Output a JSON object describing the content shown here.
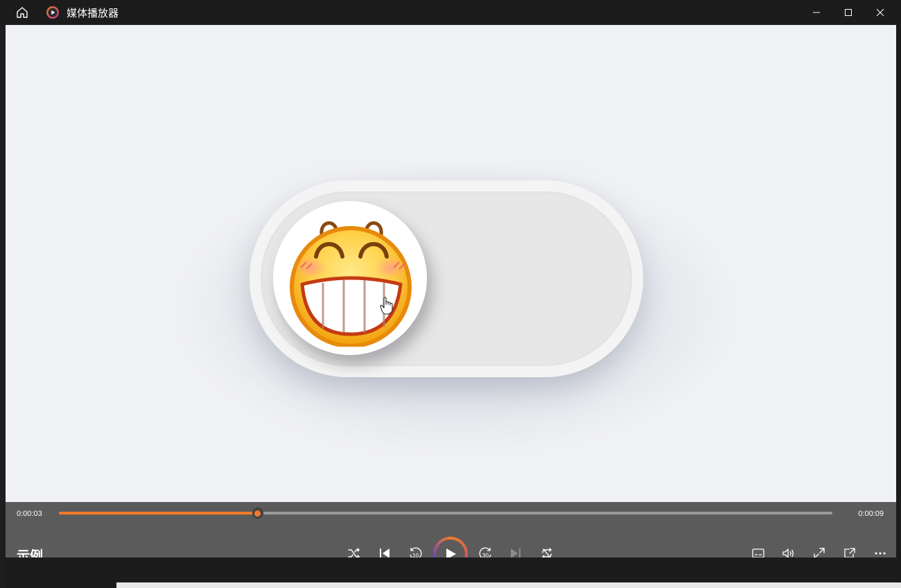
{
  "window": {
    "title": "媒体播放器"
  },
  "player": {
    "current_time": "0:00:03",
    "duration": "0:00:09",
    "progress_fraction": 0.257,
    "media_title": "示例",
    "accent_color": "#f27a28"
  },
  "controls": [
    {
      "name": "shuffle-button",
      "icon": "shuffle-icon"
    },
    {
      "name": "previous-button",
      "icon": "skip-previous-icon"
    },
    {
      "name": "rewind-10-button",
      "icon": "rewind-10-icon",
      "label": "10"
    },
    {
      "name": "play-button",
      "icon": "play-icon"
    },
    {
      "name": "forward-30-button",
      "icon": "forward-30-icon",
      "label": "30"
    },
    {
      "name": "next-button",
      "icon": "skip-next-icon"
    },
    {
      "name": "repeat-button",
      "icon": "repeat-icon"
    },
    {
      "name": "subtitles-button",
      "icon": "subtitles-icon"
    },
    {
      "name": "volume-button",
      "icon": "volume-icon"
    },
    {
      "name": "fullscreen-button",
      "icon": "expand-icon"
    },
    {
      "name": "mini-player-button",
      "icon": "mini-player-icon"
    },
    {
      "name": "more-options-button",
      "icon": "more-icon"
    }
  ]
}
